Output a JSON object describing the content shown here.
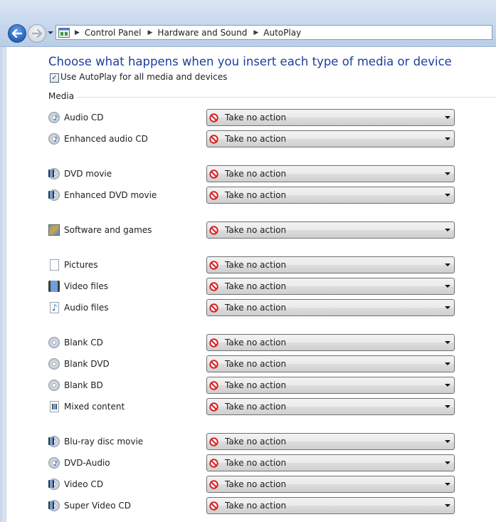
{
  "breadcrumb": [
    "Control Panel",
    "Hardware and Sound",
    "AutoPlay"
  ],
  "heading": "Choose what happens when you insert each type of media or device",
  "autoplay_checkbox": {
    "label": "Use AutoPlay for all media and devices",
    "checked": true
  },
  "media_section_label": "Media",
  "no_action_color": "#d81e1e",
  "rows": [
    {
      "label": "Audio CD",
      "icon": "audio-cd-icon",
      "action": "Take no action"
    },
    {
      "label": "Enhanced audio CD",
      "icon": "enhanced-audio-cd-icon",
      "action": "Take no action"
    },
    {
      "label": "DVD movie",
      "icon": "dvd-movie-icon",
      "action": "Take no action"
    },
    {
      "label": "Enhanced DVD movie",
      "icon": "enhanced-dvd-movie-icon",
      "action": "Take no action"
    },
    {
      "label": "Software and games",
      "icon": "software-games-icon",
      "action": "Take no action"
    },
    {
      "label": "Pictures",
      "icon": "pictures-icon",
      "action": "Take no action"
    },
    {
      "label": "Video files",
      "icon": "video-files-icon",
      "action": "Take no action"
    },
    {
      "label": "Audio files",
      "icon": "audio-files-icon",
      "action": "Take no action"
    },
    {
      "label": "Blank CD",
      "icon": "blank-cd-icon",
      "action": "Take no action"
    },
    {
      "label": "Blank DVD",
      "icon": "blank-dvd-icon",
      "action": "Take no action"
    },
    {
      "label": "Blank BD",
      "icon": "blank-bd-icon",
      "action": "Take no action"
    },
    {
      "label": "Mixed content",
      "icon": "mixed-content-icon",
      "action": "Take no action"
    },
    {
      "label": "Blu-ray disc movie",
      "icon": "bluray-movie-icon",
      "action": "Take no action"
    },
    {
      "label": "DVD-Audio",
      "icon": "dvd-audio-icon",
      "action": "Take no action"
    },
    {
      "label": "Video CD",
      "icon": "video-cd-icon",
      "action": "Take no action"
    },
    {
      "label": "Super Video CD",
      "icon": "super-video-cd-icon",
      "action": "Take no action"
    }
  ]
}
